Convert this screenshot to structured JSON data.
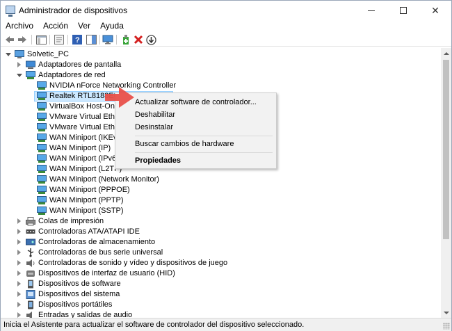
{
  "window": {
    "title": "Administrador de dispositivos"
  },
  "menu": [
    "Archivo",
    "Acción",
    "Ver",
    "Ayuda"
  ],
  "toolbar": {
    "buttons": [
      "back-icon",
      "forward-icon",
      "show-hide-console-tree-icon",
      "properties-icon",
      "help-icon",
      "show-action-pane-icon",
      "monitor-icon",
      "add-driver-icon",
      "uninstall-icon",
      "update-driver-icon"
    ]
  },
  "tree": {
    "root": "Solvetic_PC",
    "categories_top": [
      "Adaptadores de pantalla",
      "Adaptadores de red"
    ],
    "network_adapters": [
      "NVIDIA nForce Networking Controller",
      "Realtek RTL8188EU W",
      "VirtualBox Host-Only",
      "VMware Virtual Ether",
      "VMware Virtual Ether",
      "WAN Miniport (IKEv2",
      "WAN Miniport (IP)",
      "WAN Miniport (IPv6)",
      "WAN Miniport (L2TP)",
      "WAN Miniport (Network Monitor)",
      "WAN Miniport (PPPOE)",
      "WAN Miniport (PPTP)",
      "WAN Miniport (SSTP)"
    ],
    "categories_bottom": [
      "Colas de impresión",
      "Controladoras ATA/ATAPI IDE",
      "Controladoras de almacenamiento",
      "Controladoras de bus serie universal",
      "Controladoras de sonido y vídeo y dispositivos de juego",
      "Dispositivos de interfaz de usuario (HID)",
      "Dispositivos de software",
      "Dispositivos del sistema",
      "Dispositivos portátiles",
      "Entradas y salidas de audio"
    ]
  },
  "context_menu": {
    "update": "Actualizar software de controlador...",
    "disable": "Deshabilitar",
    "uninstall": "Desinstalar",
    "scan": "Buscar cambios de hardware",
    "properties": "Propiedades"
  },
  "status": "Inicia el Asistente para actualizar el software de controlador del dispositivo seleccionado.",
  "colors": {
    "selection": "#cce8ff",
    "annotation_arrow": "#e8504a"
  }
}
